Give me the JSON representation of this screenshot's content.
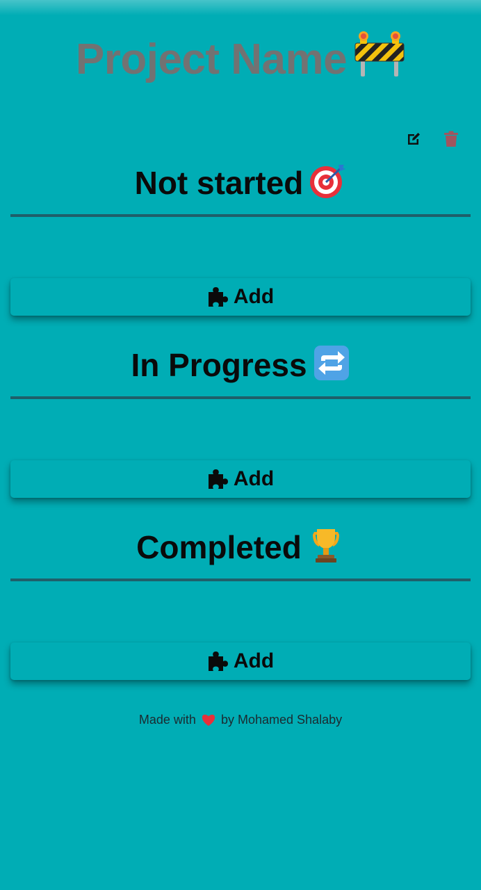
{
  "project": {
    "title": "Project Name",
    "icon": "construction-barrier-icon"
  },
  "toolbar": {
    "edit_icon": "edit-icon",
    "delete_icon": "trash-icon",
    "delete_color": "#a0555e"
  },
  "columns": [
    {
      "title": "Not started",
      "icon": "target-icon",
      "add_label": "Add"
    },
    {
      "title": "In Progress",
      "icon": "repeat-arrows-icon",
      "add_label": "Add"
    },
    {
      "title": "Completed",
      "icon": "trophy-icon",
      "add_label": "Add"
    }
  ],
  "footer": {
    "prefix": "Made with",
    "suffix": "by Mohamed Shalaby",
    "icon": "heart-icon",
    "heart_color": "#e8303a"
  },
  "colors": {
    "background": "#00adb5",
    "title_text": "#727272",
    "rule": "#1f5f6a"
  }
}
